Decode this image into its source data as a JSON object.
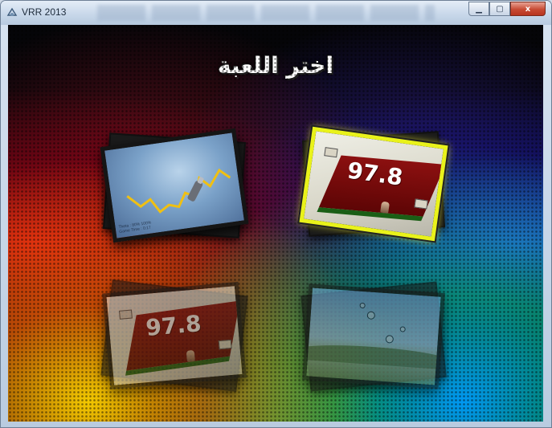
{
  "window": {
    "title": "VRR 2013",
    "minimize_glyph": "▁",
    "maximize_glyph": "▢",
    "close_glyph": "x",
    "icons": {
      "app": "vrr-app-icon"
    }
  },
  "screen": {
    "heading": "اختر اللعبة"
  },
  "games": [
    {
      "id": "graph-game",
      "selected": false,
      "overlay_text": [
        "Theta : 80% 100%",
        "Game Time : 0:17"
      ]
    },
    {
      "id": "score-game-1",
      "selected": true,
      "score": "97.8"
    },
    {
      "id": "score-game-2",
      "selected": false,
      "score": "97.8"
    },
    {
      "id": "scene-game",
      "selected": false
    }
  ],
  "colors": {
    "selection_border": "#e9f21a",
    "titlebar": "#c9d8ea",
    "close_button": "#c74a33"
  }
}
